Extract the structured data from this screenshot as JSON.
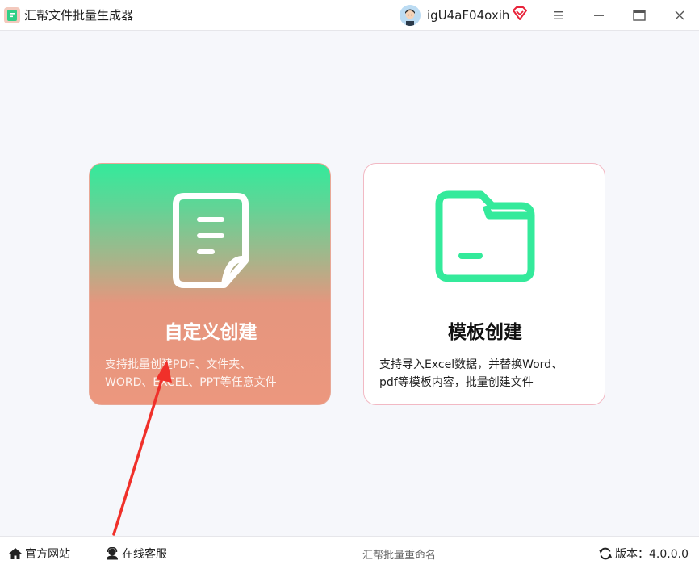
{
  "app": {
    "title": "汇帮文件批量生成器",
    "username": "igU4aF04oxih",
    "icons": [
      "app-logo",
      "user-avatar",
      "vip-diamond-icon",
      "menu-icon",
      "minimize-icon",
      "maximize-icon",
      "close-icon"
    ]
  },
  "cards": {
    "custom": {
      "icon": "document-icon",
      "title": "自定义创建",
      "desc_line1": "支持批量创建PDF、文件夹、",
      "desc_line2": "WORD、EXCEL、PPT等任意文件"
    },
    "template": {
      "icon": "folder-icon",
      "title": "模板创建",
      "desc_line1": "支持导入Excel数据，并替换Word、",
      "desc_line2": "pdf等模板内容，批量创建文件"
    }
  },
  "footer": {
    "site_label": "官方网站",
    "service_label": "在线客服",
    "rename_label": "汇帮批量重命名",
    "version_label": "版本：4.0.0.0"
  },
  "colors": {
    "accent_green": "#34ea9b",
    "accent_salmon": "#ec977e",
    "annotation_red": "#f0302a"
  }
}
